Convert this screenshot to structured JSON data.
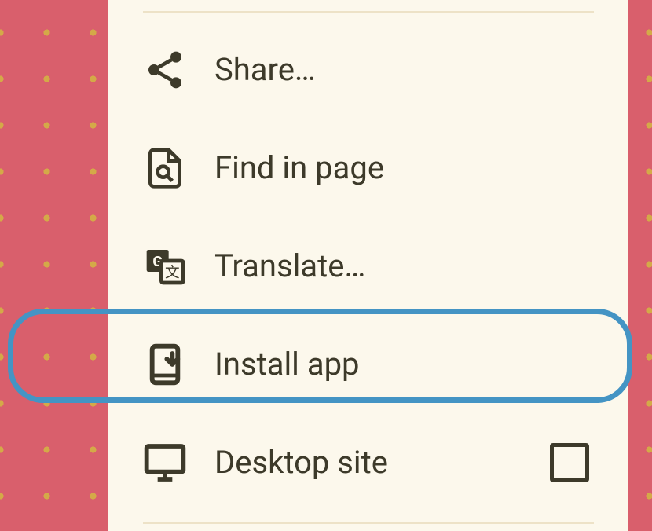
{
  "menu": {
    "items": [
      {
        "label": "Share…",
        "icon": "share-icon"
      },
      {
        "label": "Find in page",
        "icon": "find-in-page-icon"
      },
      {
        "label": "Translate…",
        "icon": "translate-icon"
      },
      {
        "label": "Install app",
        "icon": "install-app-icon",
        "highlighted": true
      },
      {
        "label": "Desktop site",
        "icon": "desktop-icon",
        "hasCheckbox": true,
        "checked": false
      }
    ]
  },
  "colors": {
    "background": "#d95f6c",
    "dots": "#d4a948",
    "panel": "#fcf8ec",
    "text": "#3d3a2a",
    "highlight": "#4494c4"
  }
}
